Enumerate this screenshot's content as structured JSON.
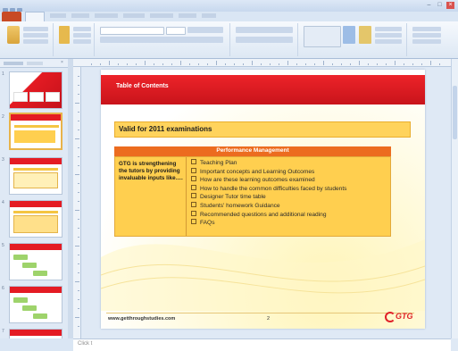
{
  "colors": {
    "accent_red": "#e41b23",
    "gold": "#ffd35c",
    "orange_header": "#ec6c1f",
    "ribbon_bg": "#dde8f4",
    "file_tab": "#c84a25"
  },
  "slide": {
    "title": "Table of Contents",
    "valid_text": "Valid for 2011 examinations",
    "table_header": "Performance Management",
    "left_cell": "GTG is strengthening the tutors by providing invaluable inputs like….",
    "items": [
      "Teaching Plan",
      "Important concepts and Learning Outcomes",
      "How are these learning outcomes examined",
      "How to handle the common difficulties faced by students",
      "Designer Tutor time table",
      "Students' homework Guidance",
      "Recommended questions and additional reading",
      "FAQs"
    ],
    "footer_url": "www.getthroughstudies.com",
    "footer_page": "2",
    "logo_text": "GTG"
  },
  "slide_numbers": [
    "1",
    "2",
    "3",
    "4",
    "5",
    "6",
    "7"
  ],
  "notes_placeholder": "Click t"
}
